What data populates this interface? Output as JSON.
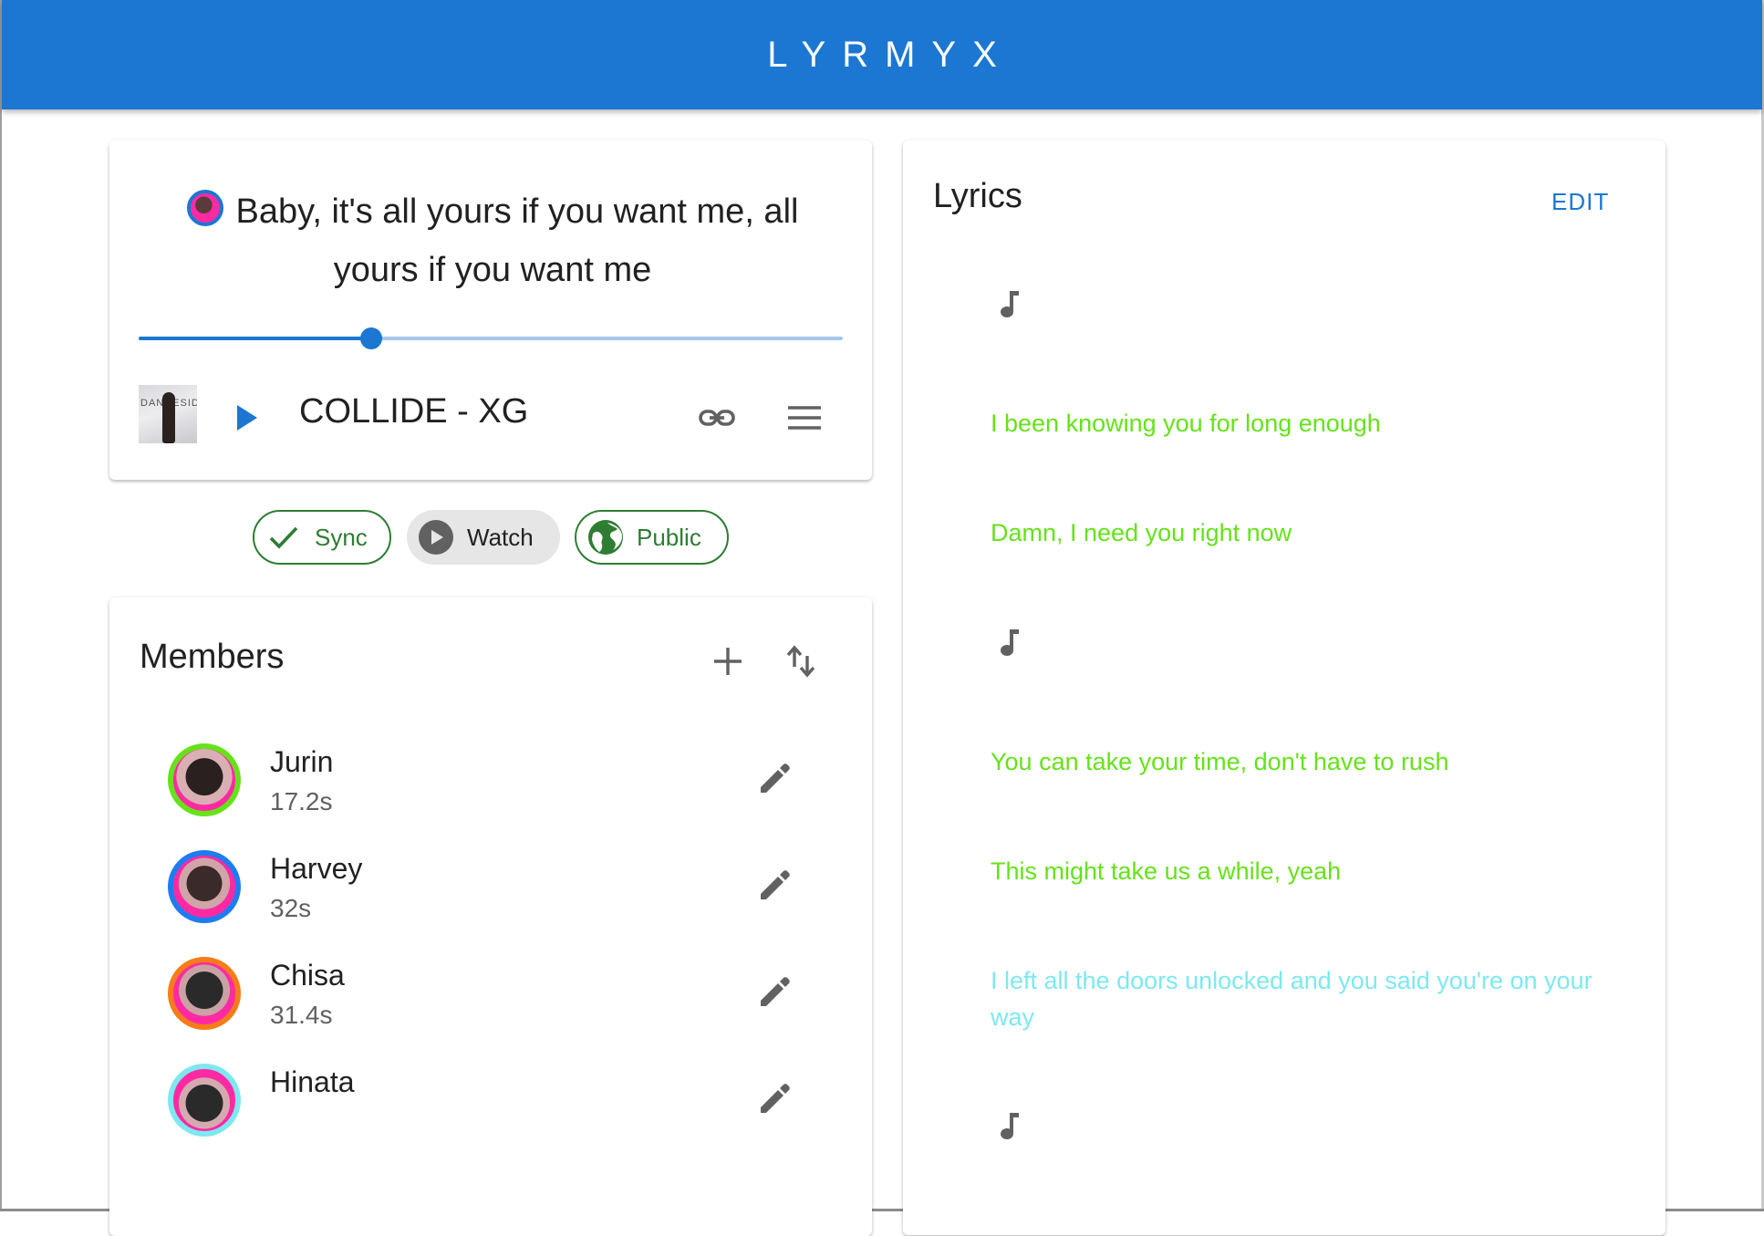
{
  "app": {
    "title": "LYRMYX"
  },
  "now_playing": {
    "current_lyric": "Baby, it's all yours if you want me, all yours if you want me",
    "progress": 0.33,
    "song_title": "COLLIDE - XG",
    "album_art_text": "DANCESIDE"
  },
  "chips": {
    "sync": {
      "label": "Sync",
      "icon": "check-icon"
    },
    "watch": {
      "label": "Watch",
      "icon": "play-circle-icon"
    },
    "public": {
      "label": "Public",
      "icon": "globe-icon"
    }
  },
  "members": {
    "title": "Members",
    "list": [
      {
        "name": "Jurin",
        "time": "17.2s",
        "color": "#66e21a"
      },
      {
        "name": "Harvey",
        "time": "32s",
        "color": "#1e7cf2"
      },
      {
        "name": "Chisa",
        "time": "31.4s",
        "color": "#f57c18"
      },
      {
        "name": "Hinata",
        "time": "",
        "color": "#7ee8f0"
      }
    ]
  },
  "lyrics": {
    "title": "Lyrics",
    "edit_label": "EDIT",
    "lines": [
      {
        "text": "I been knowing you for long enough",
        "color": "#66e21a"
      },
      {
        "text": "Damn, I need you right now",
        "color": "#66e21a"
      },
      {
        "text": "You can take your time, don't have to rush",
        "color": "#66e21a"
      },
      {
        "text": "This might take us a while, yeah",
        "color": "#66e21a"
      },
      {
        "text": "I left all the doors unlocked and you said you're on your way",
        "color": "#7ee8f0"
      }
    ]
  },
  "colors": {
    "primary": "#1b77d2",
    "chip_green": "#2e7d32",
    "slider_track_light": "#a4c8ec"
  }
}
